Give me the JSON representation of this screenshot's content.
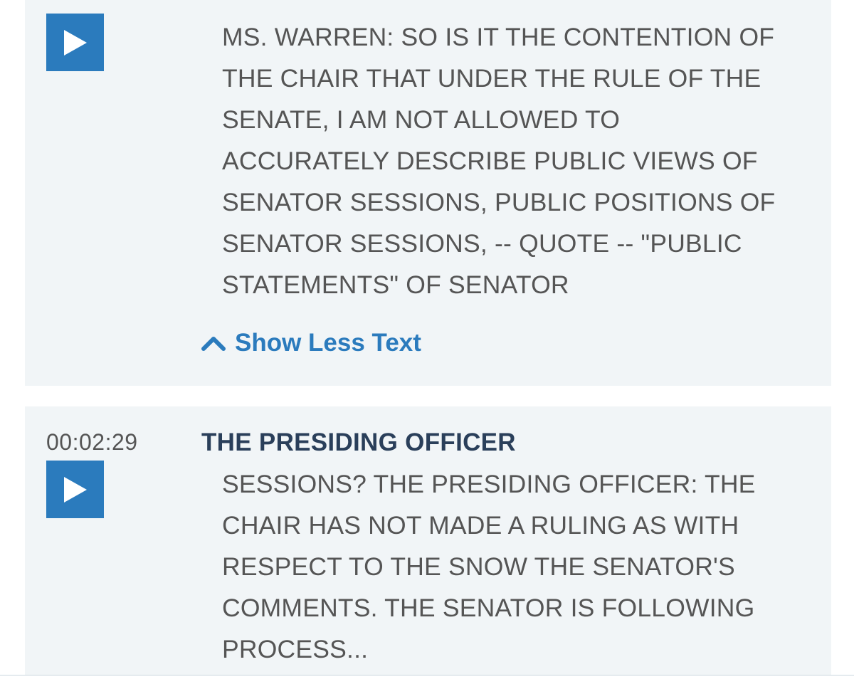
{
  "entries": [
    {
      "transcript": "MS. WARREN: SO IS IT THE CONTENTION OF\nTHE CHAIR THAT UNDER THE RULE OF THE\nSENATE, I AM NOT ALLOWED TO\nACCURATELY DESCRIBE PUBLIC VIEWS OF\nSENATOR SESSIONS, PUBLIC POSITIONS OF\nSENATOR SESSIONS, -- QUOTE -- \"PUBLIC\nSTATEMENTS\" OF SENATOR",
      "toggle_label": "Show Less Text",
      "play_icon": "play-icon",
      "toggle_icon": "chevron-up-icon"
    },
    {
      "timestamp": "00:02:29",
      "speaker": "THE PRESIDING OFFICER",
      "transcript": "SESSIONS? THE PRESIDING OFFICER: THE\nCHAIR HAS NOT MADE A RULING AS WITH\nRESPECT TO THE SNOW THE SENATOR'S\nCOMMENTS. THE SENATOR IS FOLLOWING\nPROCESS...",
      "play_icon": "play-icon"
    }
  ],
  "colors": {
    "accent": "#2b7bbd",
    "card_background": "#f1f5f7",
    "speaker_text": "#2a3f5a",
    "body_text": "#555555"
  }
}
